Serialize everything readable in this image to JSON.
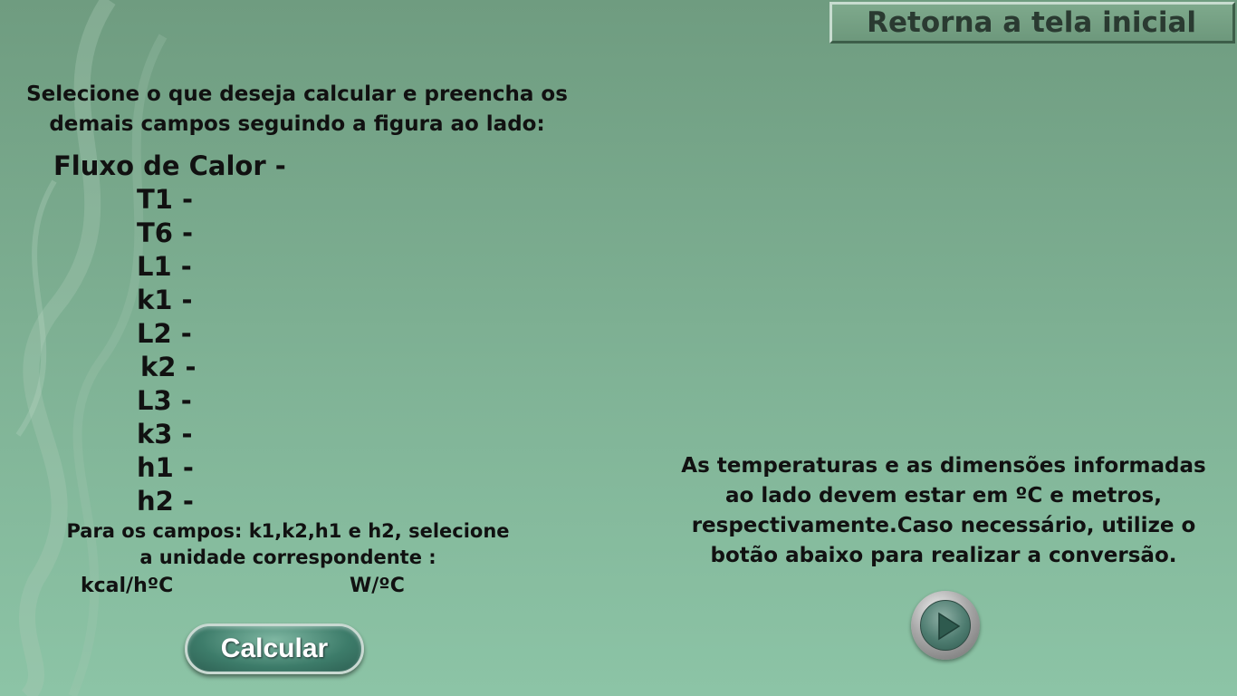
{
  "header": {
    "home_button_label": "Retorna a tela inicial"
  },
  "instruction": {
    "line1": "Selecione o que deseja calcular e preencha os",
    "line2": "demais campos seguindo a figura ao lado:"
  },
  "fields": [
    {
      "label": "Fluxo de Calor -"
    },
    {
      "label": "T1 -"
    },
    {
      "label": "T6 -"
    },
    {
      "label": "L1 -"
    },
    {
      "label": "k1 -"
    },
    {
      "label": "L2 -"
    },
    {
      "label": "k2 -"
    },
    {
      "label": "L3 -"
    },
    {
      "label": "k3 -"
    },
    {
      "label": "h1 -"
    },
    {
      "label": "h2 -"
    }
  ],
  "unit_note": {
    "line1": "Para os campos: k1,k2,h1 e h2, selecione",
    "line2": "a unidade correspondente :"
  },
  "unit_options": [
    "kcal/hºC",
    "W/ºC"
  ],
  "calculate_button_label": "Calcular",
  "info": {
    "line1": "As temperaturas e as dimensões informadas",
    "line2": "ao lado devem estar em ºC e metros,",
    "line3": "respectivamente.Caso necessário, utilize o",
    "line4": "botão abaixo para realizar a conversão."
  },
  "convert_button": {
    "icon": "play-icon"
  },
  "colors": {
    "background_top": "#6f9c80",
    "background_bottom": "#8cc4a6",
    "button_green": "#3d7c6a"
  }
}
